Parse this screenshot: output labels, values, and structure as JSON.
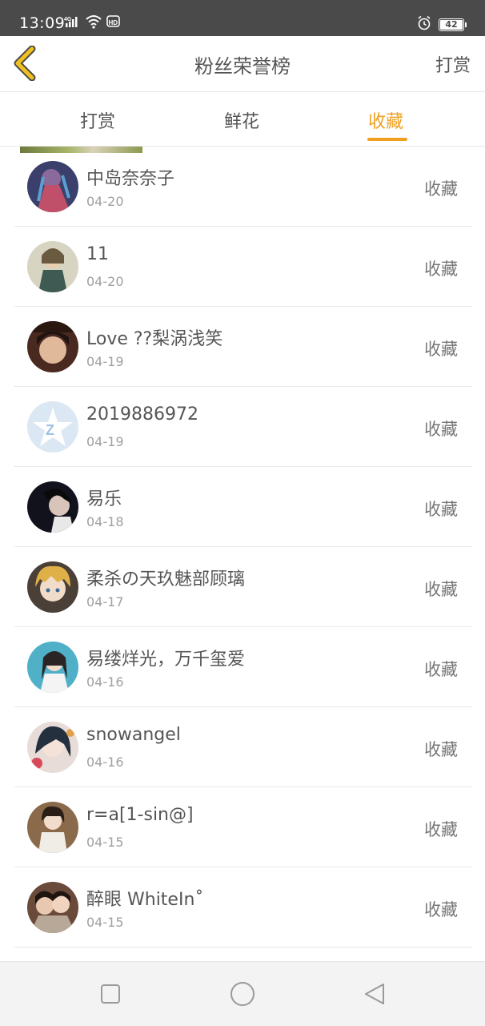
{
  "status_bar": {
    "time": "13:09",
    "network": "4G",
    "hd": "HD",
    "battery": "42"
  },
  "header": {
    "title": "粉丝荣誉榜",
    "action_label": "打赏",
    "back_icon": "chevron-left-icon"
  },
  "tabs": [
    {
      "label": "打赏",
      "active": false
    },
    {
      "label": "鲜花",
      "active": false
    },
    {
      "label": "收藏",
      "active": true
    }
  ],
  "colors": {
    "accent": "#f0a020",
    "text": "#555555",
    "muted": "#a0a0a0"
  },
  "fans": [
    {
      "name": "中岛奈奈子",
      "date": "04-20",
      "action": "收藏"
    },
    {
      "name": "11",
      "date": "04-20",
      "action": "收藏"
    },
    {
      "name": "Love ??梨涡浅笑",
      "date": "04-19",
      "action": "收藏"
    },
    {
      "name": "2019886972",
      "date": "04-19",
      "action": "收藏"
    },
    {
      "name": "易乐",
      "date": "04-18",
      "action": "收藏"
    },
    {
      "name": "柔杀の天玖魅部顾璃",
      "date": "04-17",
      "action": "收藏"
    },
    {
      "name": "易缕烊光，万千玺爱",
      "date": "04-16",
      "action": "收藏"
    },
    {
      "name": "snowangel",
      "date": "04-16",
      "action": "收藏"
    },
    {
      "name": "r=a[1-sin@]",
      "date": "04-15",
      "action": "收藏"
    },
    {
      "name": "醉眼 WhiteIn˚",
      "date": "04-15",
      "action": "收藏"
    }
  ],
  "nav_bar": {
    "recent_icon": "square-icon",
    "home_icon": "circle-icon",
    "back_icon": "triangle-back-icon"
  }
}
